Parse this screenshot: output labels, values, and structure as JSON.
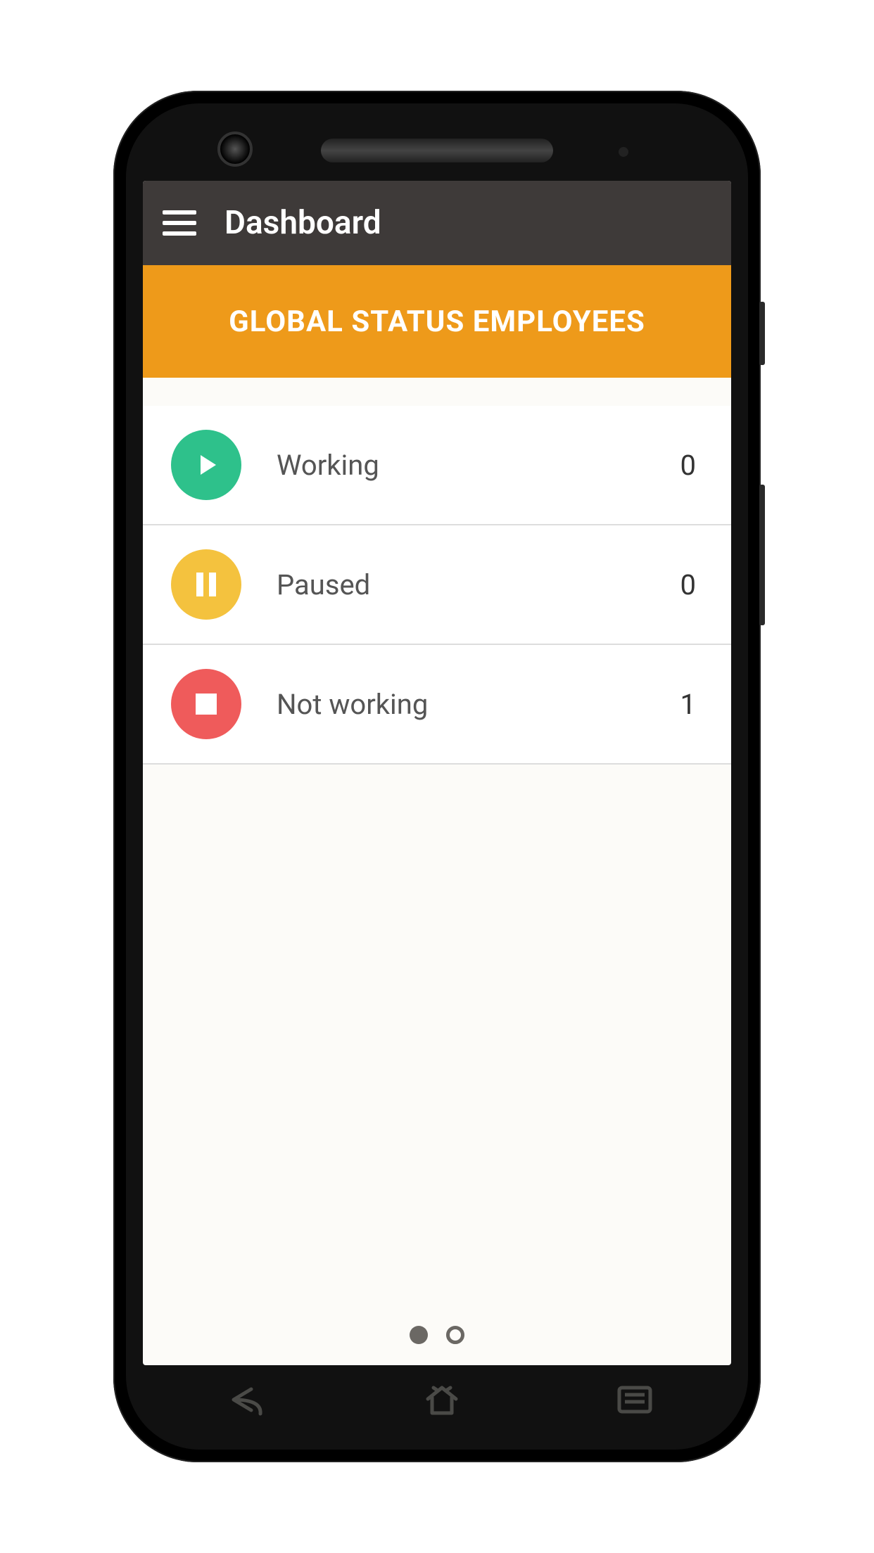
{
  "header": {
    "title": "Dashboard"
  },
  "banner": {
    "title": "GLOBAL STATUS EMPLOYEES"
  },
  "status_rows": [
    {
      "icon": "play",
      "color": "#2ec18b",
      "label": "Working",
      "count": 0
    },
    {
      "icon": "pause",
      "color": "#f4c23e",
      "label": "Paused",
      "count": 0
    },
    {
      "icon": "stop",
      "color": "#ef5b5b",
      "label": "Not working",
      "count": 1
    }
  ],
  "pager": {
    "total": 2,
    "active": 0
  }
}
